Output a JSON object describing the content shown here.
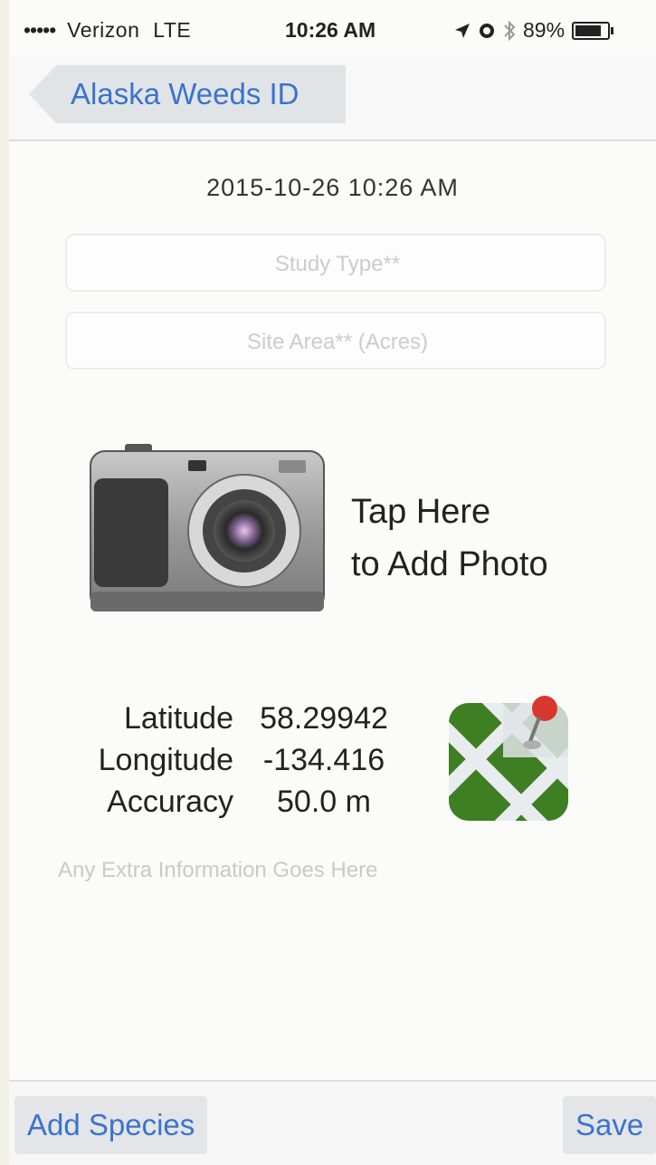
{
  "status_bar": {
    "signal": "•••••",
    "carrier": "Verizon",
    "network": "LTE",
    "time": "10:26 AM",
    "battery": "89%"
  },
  "nav": {
    "back_label": "Alaska Weeds ID"
  },
  "form": {
    "datetime": "2015-10-26 10:26 AM",
    "study_type_placeholder": "Study Type**",
    "site_area_placeholder": "Site Area** (Acres)",
    "photo_line1": "Tap Here",
    "photo_line2": "to Add Photo",
    "extra_placeholder": "Any Extra Information Goes Here"
  },
  "location": {
    "latitude_label": "Latitude",
    "latitude_value": "58.29942",
    "longitude_label": "Longitude",
    "longitude_value": "-134.416",
    "accuracy_label": "Accuracy",
    "accuracy_value": "50.0 m"
  },
  "toolbar": {
    "add_species_label": "Add Species",
    "save_label": "Save"
  },
  "icons": [
    "location-arrow-icon",
    "alarm-icon",
    "bluetooth-icon",
    "battery-icon",
    "camera-icon",
    "map-pin-icon"
  ],
  "colors": {
    "accent": "#3a74cc",
    "map_green": "#4a8a2a"
  }
}
